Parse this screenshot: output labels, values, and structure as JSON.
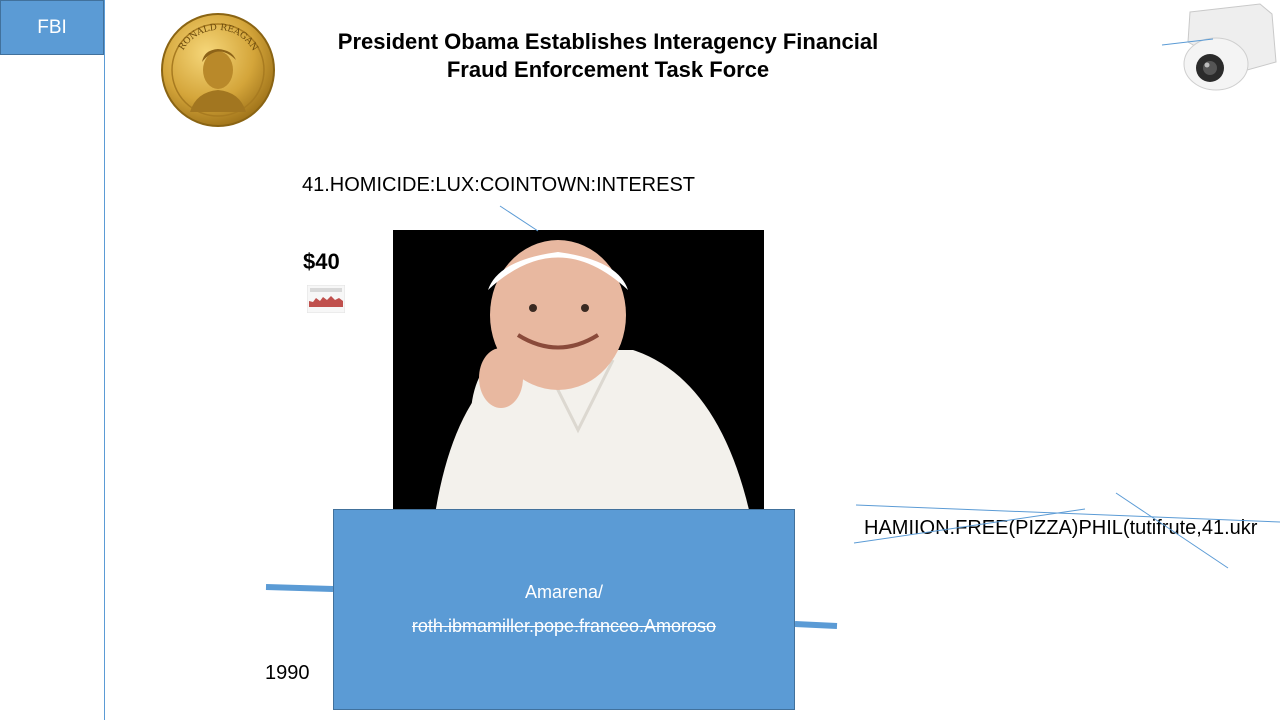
{
  "tab": {
    "label": "FBI"
  },
  "header": {
    "title_line1": "President Obama Establishes Interagency Financial",
    "title_line2": "Fraud Enforcement Task Force",
    "coin_text": "RONALD REAGAN"
  },
  "labels": {
    "homicide": "41.HOMICIDE:LUX:COINTOWN:INTEREST",
    "price": "$40",
    "hamilton": "HAMIION.FREE(PIZZA)PHIL(tutifrute,41.ukr",
    "year": "1990"
  },
  "blue_box": {
    "line1": "Amarena/",
    "line2": "roth.ibmamiller.pope.franceo.Amoroso"
  },
  "colors": {
    "accent": "#5b9bd5",
    "accent_border": "#41719c",
    "coin_gold": "#d4a53a",
    "chart_red": "#c0504d"
  },
  "icons": {
    "coin": "coin-portrait-icon",
    "camera": "security-camera-icon"
  }
}
